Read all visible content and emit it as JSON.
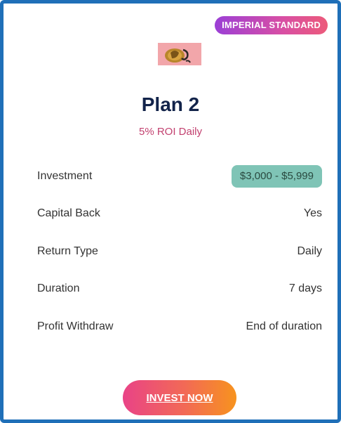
{
  "badge": {
    "label": "IMPERIAL STANDARD"
  },
  "plan": {
    "title": "Plan 2",
    "roi": "5% ROI Daily"
  },
  "details": {
    "investment": {
      "label": "Investment",
      "value": "$3,000 - $5,999"
    },
    "capital_back": {
      "label": "Capital Back",
      "value": "Yes"
    },
    "return_type": {
      "label": "Return Type",
      "value": "Daily"
    },
    "duration": {
      "label": "Duration",
      "value": "7 days"
    },
    "profit_withdraw": {
      "label": "Profit Withdraw",
      "value": "End of duration"
    }
  },
  "actions": {
    "invest_label": "INVEST NOW"
  },
  "colors": {
    "border": "#1f6fb8",
    "title": "#12234a",
    "roi": "#c2406f",
    "investment_pill": "#7fc4b6",
    "badge_gradient_start": "#9b3fd6",
    "badge_gradient_end": "#ec5a7a",
    "button_gradient_start": "#e94387",
    "button_gradient_end": "#f7931e"
  },
  "icons": {
    "plan_image": "coin-hand-image"
  }
}
